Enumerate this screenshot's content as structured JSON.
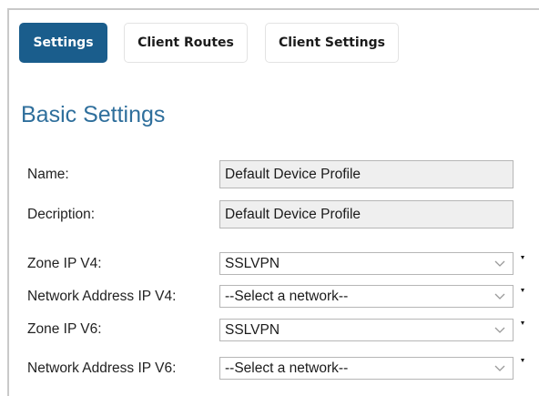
{
  "tabs": [
    {
      "label": "Settings",
      "active": true
    },
    {
      "label": "Client Routes",
      "active": false
    },
    {
      "label": "Client Settings",
      "active": false
    }
  ],
  "section_title": "Basic Settings",
  "fields": {
    "name": {
      "label": "Name:",
      "value": "Default Device Profile"
    },
    "description": {
      "label": "Decription:",
      "value": "Default Device Profile"
    },
    "zone_ipv4": {
      "label": "Zone IP V4:",
      "value": "SSLVPN"
    },
    "network_ipv4": {
      "label": "Network Address IP V4:",
      "value": "--Select a network--"
    },
    "zone_ipv6": {
      "label": "Zone IP V6:",
      "value": "SSLVPN"
    },
    "network_ipv6": {
      "label": "Network Address IP V6:",
      "value": "--Select a network--"
    }
  },
  "colors": {
    "active_tab": "#1a5d8c",
    "section_title": "#2f6f9c",
    "readonly_field_bg": "#efefef"
  },
  "icons": {
    "dropdown": "chevron-down-icon",
    "field_marker": "required-marker-icon"
  }
}
